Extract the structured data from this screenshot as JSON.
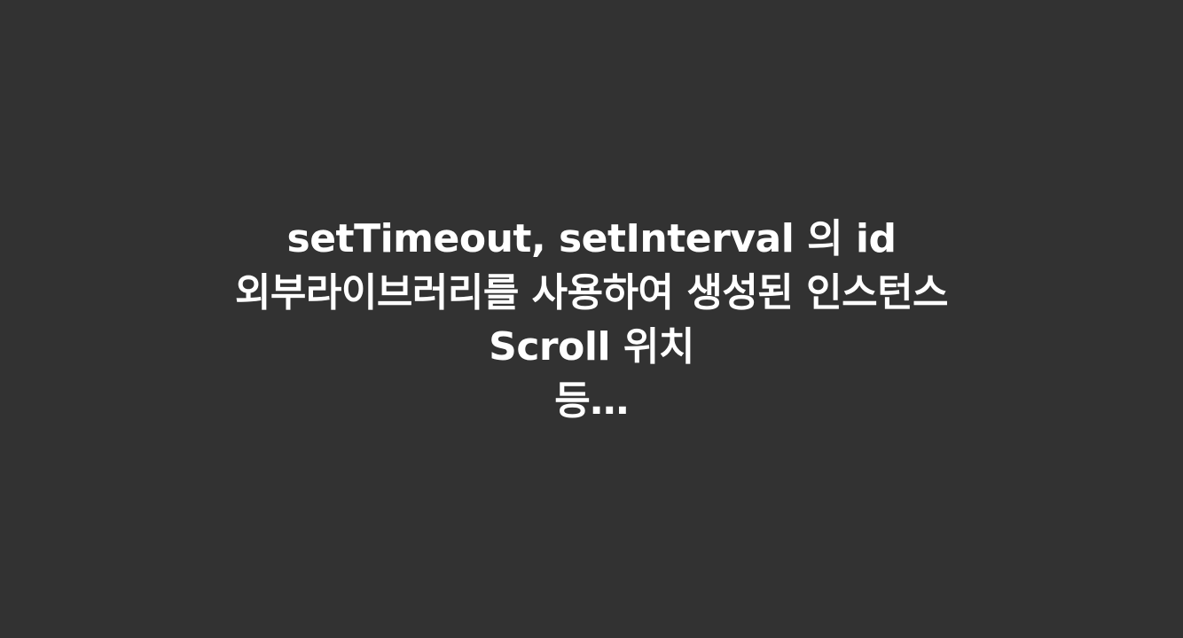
{
  "slide": {
    "lines": [
      "setTimeout, setInterval 의 id",
      "외부라이브러리를 사용하여 생성된 인스턴스",
      "Scroll 위치",
      "등…"
    ]
  },
  "colors": {
    "background": "#323232",
    "text": "#ffffff"
  }
}
